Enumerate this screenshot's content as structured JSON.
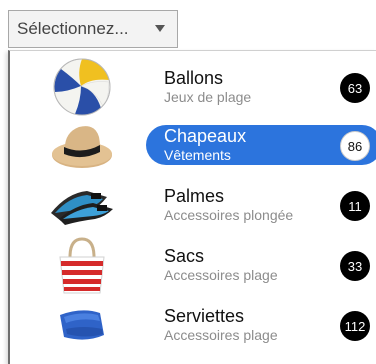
{
  "select": {
    "value": "Sélectionnez...",
    "caret_icon": "triangle-down-icon"
  },
  "items": [
    {
      "title": "Ballons",
      "subtitle": "Jeux de plage",
      "count": "63",
      "icon": "volleyball-icon",
      "selected": false
    },
    {
      "title": "Chapeaux",
      "subtitle": "Vêtements",
      "count": "86",
      "icon": "straw-hat-icon",
      "selected": true
    },
    {
      "title": "Palmes",
      "subtitle": "Accessoires plongée",
      "count": "11",
      "icon": "swim-fins-icon",
      "selected": false
    },
    {
      "title": "Sacs",
      "subtitle": "Accessoires plage",
      "count": "33",
      "icon": "striped-bag-icon",
      "selected": false
    },
    {
      "title": "Serviettes",
      "subtitle": "Accessoires plage",
      "count": "112",
      "icon": "towel-icon",
      "selected": false
    }
  ],
  "colors": {
    "highlight": "#2c74dd",
    "badge": "#000000"
  }
}
